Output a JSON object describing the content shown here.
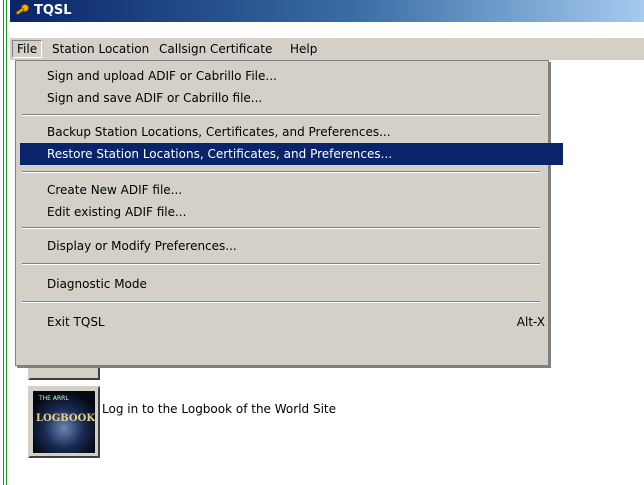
{
  "window": {
    "title": "TQSL",
    "app_icon": "key-icon"
  },
  "menubar": {
    "items": [
      {
        "label": "File"
      },
      {
        "label": "Station Location"
      },
      {
        "label": "Callsign Certificate"
      },
      {
        "label": "Help"
      }
    ]
  },
  "file_menu": {
    "items": [
      {
        "label": "Sign and upload ADIF or Cabrillo File..."
      },
      {
        "label": "Sign and save ADIF or Cabrillo file..."
      },
      {
        "label": "Backup Station Locations, Certificates, and Preferences..."
      },
      {
        "label": "Restore Station Locations, Certificates, and Preferences..."
      },
      {
        "label": "Create New ADIF file..."
      },
      {
        "label": "Edit existing ADIF file..."
      },
      {
        "label": "Display or Modify Preferences..."
      },
      {
        "label": "Diagnostic Mode"
      },
      {
        "label": "Exit TQSL",
        "accelerator": "Alt-X"
      }
    ],
    "highlighted_index": 3
  },
  "main": {
    "lotw_button_label": "Log in to the Logbook of the World Site",
    "lotw_logo_text_top": "THE ARRL",
    "lotw_logo_text": "LOGBOOK"
  },
  "colors": {
    "highlight": "#0a246a",
    "menu_bg": "#d4d0c8",
    "accent_green": "#0fa11b"
  }
}
